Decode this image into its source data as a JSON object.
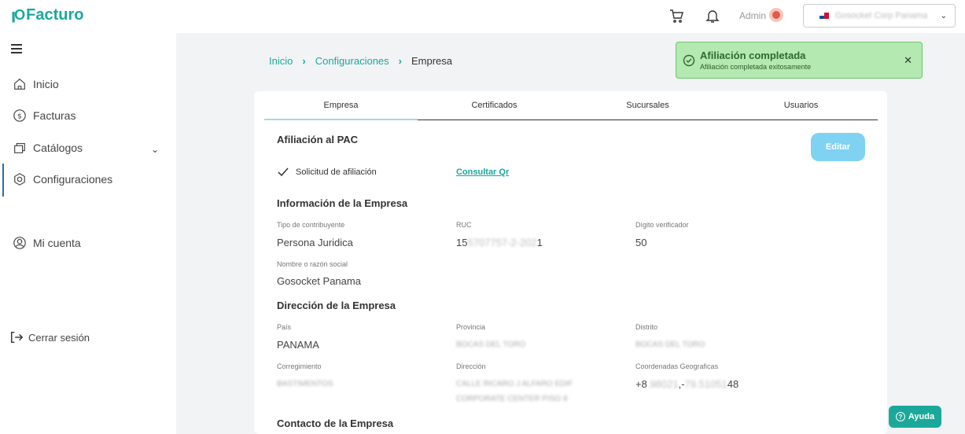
{
  "app": {
    "logo": "Facturo"
  },
  "header": {
    "user_label": "Admin",
    "company_select": "Gosocket Corp Panama",
    "icons": [
      "cart-icon",
      "bell-icon",
      "avatar",
      "chevron-down-icon"
    ]
  },
  "sidebar": {
    "items": [
      {
        "label": "Inicio",
        "icon": "home-icon"
      },
      {
        "label": "Facturas",
        "icon": "dollar-circle-icon"
      },
      {
        "label": "Catálogos",
        "icon": "catalog-icon"
      },
      {
        "label": "Configuraciones",
        "icon": "gear-icon"
      },
      {
        "label": "Mi cuenta",
        "icon": "user-circle-icon"
      },
      {
        "label": "Cerrar sesión",
        "icon": "logout-icon"
      }
    ]
  },
  "breadcrumb": {
    "home": "Inicio",
    "section": "Configuraciones",
    "current": "Empresa"
  },
  "toast": {
    "title": "Afiliación completada",
    "message": "Afiliación completada exitosamente"
  },
  "tabs": [
    "Empresa",
    "Certificados",
    "Sucursales",
    "Usuarios"
  ],
  "pac": {
    "title": "Afiliación al PAC",
    "edit_label": "Editar",
    "status_label": "Solicitud de afiliación",
    "qr_link": "Consultar Qr"
  },
  "company": {
    "title": "Información de la Empresa",
    "taxpayer_label": "Tipo de contribuyente",
    "taxpayer_value": "Persona Juridica",
    "ruc_label": "RUC",
    "ruc_prefix": "15",
    "ruc_hidden": "5707757-2-202",
    "ruc_suffix": "1",
    "dv_label": "Dígito verificador",
    "dv_value": "50",
    "name_label": "Nombre o razón social",
    "name_value": "Gosocket Panama"
  },
  "address": {
    "title": "Dirección de la Empresa",
    "country_label": "País",
    "country_value": "PANAMA",
    "province_label": "Provincia",
    "province_value": "BOCAS DEL TORO",
    "district_label": "Distrito",
    "district_value": "BOCAS DEL TORO",
    "township_label": "Corregimiento",
    "township_value": "BASTIMENTOS",
    "street_label": "Dirección",
    "street_value_1": "CALLE RICARO J ALFARO EDIF",
    "street_value_2": "CORPORATE CENTER PISO 8",
    "coords_label": "Coordenadas Geograficas",
    "coords_a": "+8",
    "coords_b": ".98021",
    "coords_c": ",-",
    "coords_d": "79.51051",
    "coords_e": "48"
  },
  "contact": {
    "title": "Contacto de la Empresa"
  },
  "help": {
    "label": "Ayuda"
  },
  "colors": {
    "brand": "#1aa89b",
    "toast_bg": "#b4e9b2",
    "edit_btn": "#7fd2f2"
  }
}
